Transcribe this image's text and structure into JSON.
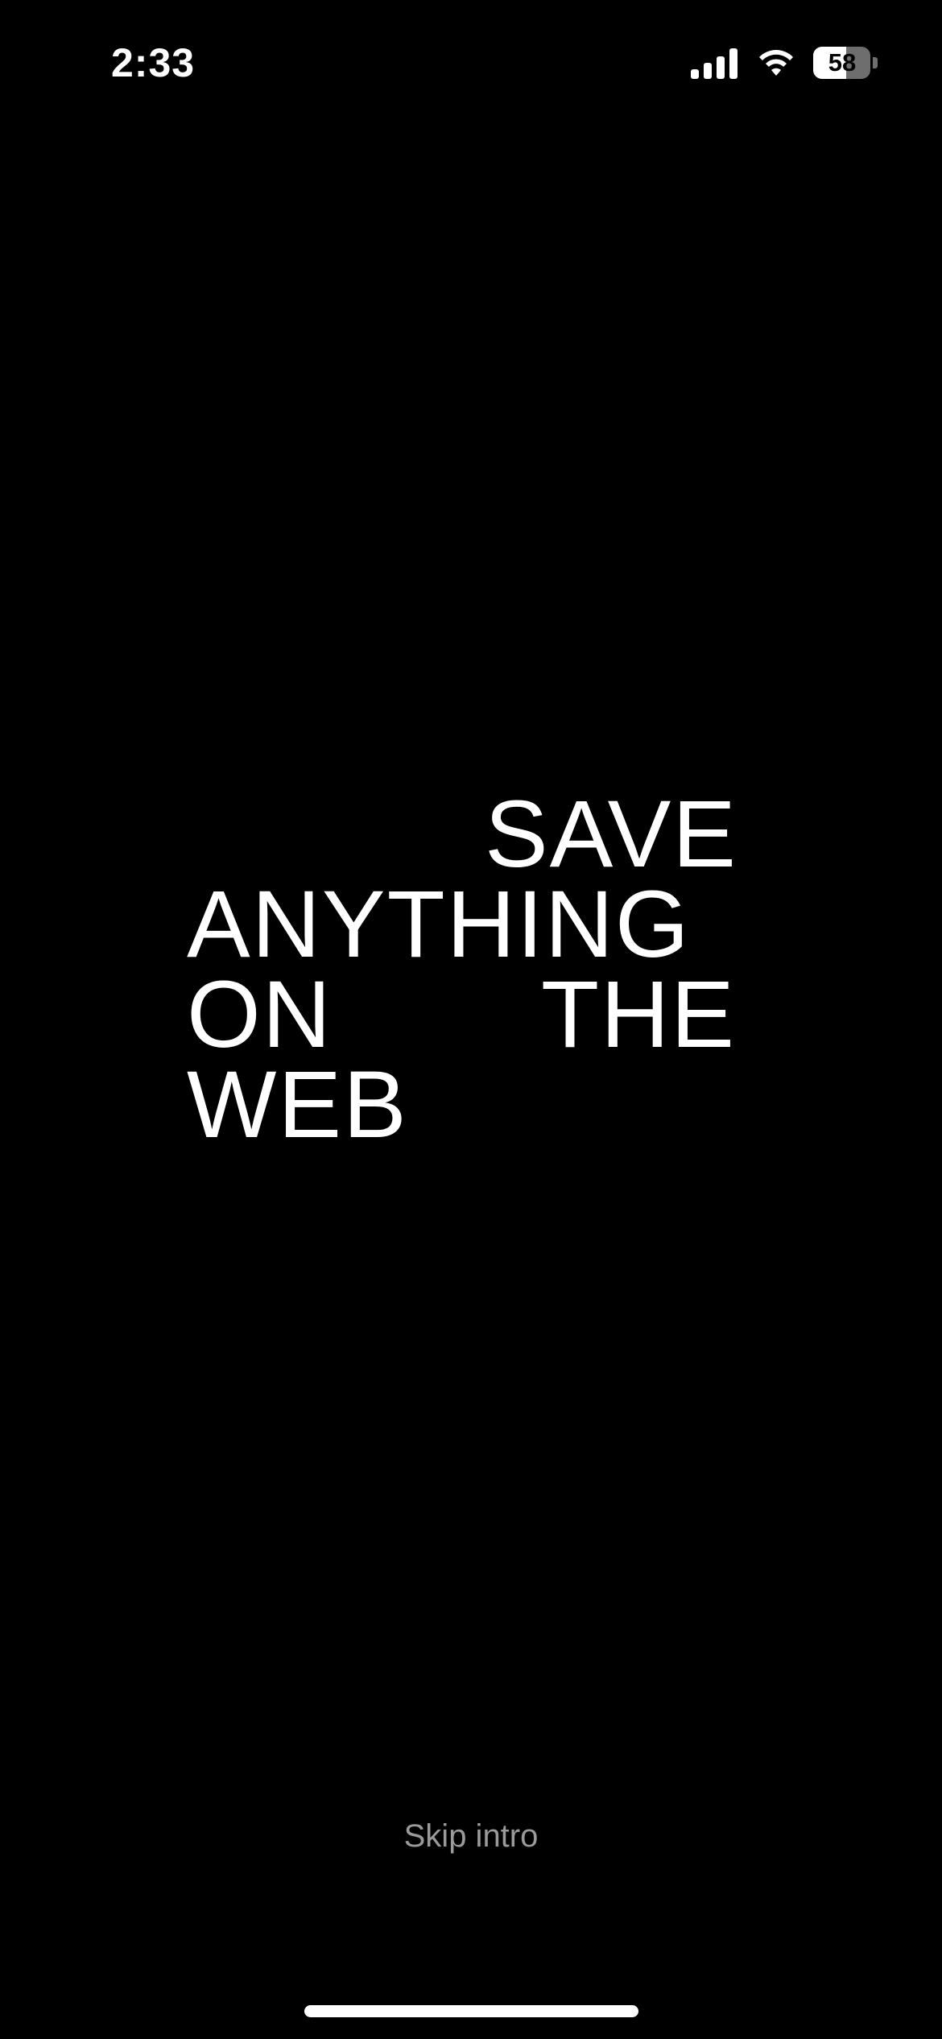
{
  "status_bar": {
    "time": "2:33",
    "battery_percent_text": "58",
    "battery_level": 0.58,
    "icons": [
      "signal-icon",
      "wifi-icon",
      "battery-icon"
    ]
  },
  "headline": {
    "line1": "SAVE",
    "line2": "ANYTHING",
    "line3_left": "ON",
    "line3_right": "THE",
    "line4": "WEB"
  },
  "skip_intro_label": "Skip intro",
  "colors": {
    "background": "#000000",
    "text_primary": "#ffffff",
    "text_secondary": "#9a9a9a"
  }
}
